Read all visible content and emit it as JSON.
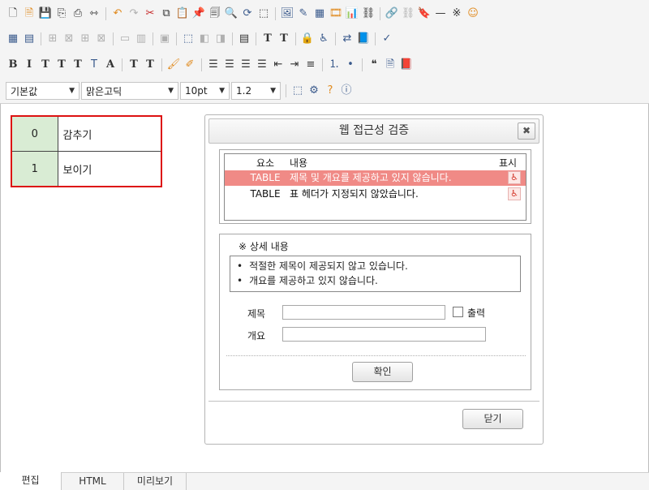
{
  "toolbar": {
    "row1": [
      {
        "name": "new-document-icon",
        "glyph": "🗋",
        "c": "k"
      },
      {
        "name": "template-icon",
        "glyph": "🗎",
        "c": "o"
      },
      {
        "name": "save-icon",
        "glyph": "💾",
        "c": ""
      },
      {
        "name": "copy-doc-icon",
        "glyph": "⎘",
        "c": "k"
      },
      {
        "name": "print-icon",
        "glyph": "⎙",
        "c": "k"
      },
      {
        "name": "page-break-icon",
        "glyph": "⇿",
        "c": "k"
      },
      {
        "sep": true
      },
      {
        "name": "undo-icon",
        "glyph": "↶",
        "c": "o"
      },
      {
        "name": "redo-icon",
        "glyph": "↷",
        "c": "g"
      },
      {
        "name": "cut-icon",
        "glyph": "✂",
        "c": "r"
      },
      {
        "name": "copy-icon",
        "glyph": "⧉",
        "c": "k"
      },
      {
        "name": "paste-icon",
        "glyph": "📋",
        "c": "o"
      },
      {
        "name": "paste-special-icon",
        "glyph": "📌",
        "c": "k"
      },
      {
        "name": "paste-text-icon",
        "glyph": "🗐",
        "c": "k"
      },
      {
        "name": "find-icon",
        "glyph": "🔍",
        "c": "k"
      },
      {
        "name": "replace-icon",
        "glyph": "⟳",
        "c": ""
      },
      {
        "name": "select-all-icon",
        "glyph": "⬚",
        "c": "k"
      },
      {
        "sep": true
      },
      {
        "name": "image-icon",
        "glyph": "🖼",
        "c": ""
      },
      {
        "name": "edit-image-icon",
        "glyph": "✎",
        "c": ""
      },
      {
        "name": "background-icon",
        "glyph": "▦",
        "c": ""
      },
      {
        "name": "media-icon",
        "glyph": "🎞",
        "c": "o"
      },
      {
        "name": "chart-icon",
        "glyph": "📊",
        "c": ""
      },
      {
        "name": "link-icon",
        "glyph": "⛓",
        "c": "k"
      },
      {
        "sep": true
      },
      {
        "name": "hyperlink-icon",
        "glyph": "🔗",
        "c": "k"
      },
      {
        "name": "unlink-icon",
        "glyph": "⛓",
        "c": "g"
      },
      {
        "name": "bookmark-icon",
        "glyph": "🔖",
        "c": ""
      },
      {
        "name": "horizontal-line-icon",
        "glyph": "—",
        "c": "k"
      },
      {
        "name": "special-char-icon",
        "glyph": "※",
        "c": "k"
      },
      {
        "name": "emoticon-icon",
        "glyph": "☺",
        "c": "o"
      }
    ],
    "row2": [
      {
        "name": "table-icon",
        "glyph": "▦",
        "c": ""
      },
      {
        "name": "table-props-icon",
        "glyph": "▤",
        "c": ""
      },
      {
        "sep": true
      },
      {
        "name": "insert-row-icon",
        "glyph": "⊞",
        "c": "g"
      },
      {
        "name": "delete-row-icon",
        "glyph": "⊠",
        "c": "g"
      },
      {
        "name": "insert-col-icon",
        "glyph": "⊞",
        "c": "g"
      },
      {
        "name": "delete-col-icon",
        "glyph": "⊠",
        "c": "g"
      },
      {
        "sep": true
      },
      {
        "name": "merge-cells-icon",
        "glyph": "▭",
        "c": "g"
      },
      {
        "name": "split-cells-icon",
        "glyph": "▥",
        "c": "g"
      },
      {
        "sep": true
      },
      {
        "name": "cell-props-icon",
        "glyph": "▣",
        "c": "g"
      },
      {
        "sep": true
      },
      {
        "name": "layer-icon",
        "glyph": "⬚",
        "c": ""
      },
      {
        "name": "bring-front-icon",
        "glyph": "◧",
        "c": "g"
      },
      {
        "name": "send-back-icon",
        "glyph": "◨",
        "c": "g"
      },
      {
        "sep": true
      },
      {
        "name": "form-icon",
        "glyph": "▤",
        "c": "k"
      },
      {
        "sep": true
      },
      {
        "name": "text-underline-t-icon",
        "glyph": "T",
        "c": "txt"
      },
      {
        "name": "text-style-t-icon",
        "glyph": "T",
        "c": "txt"
      },
      {
        "sep": true
      },
      {
        "name": "lock-icon",
        "glyph": "🔒",
        "c": "o"
      },
      {
        "name": "accessibility-icon",
        "glyph": "♿",
        "c": ""
      },
      {
        "sep": true
      },
      {
        "name": "translate-icon",
        "glyph": "⇄",
        "c": ""
      },
      {
        "name": "dictionary-icon",
        "glyph": "📘",
        "c": ""
      },
      {
        "sep": true
      },
      {
        "name": "spellcheck-icon",
        "glyph": "✓",
        "c": ""
      }
    ],
    "row3": [
      {
        "name": "bold-icon",
        "glyph": "B",
        "c": "txt"
      },
      {
        "name": "italic-icon",
        "glyph": "I",
        "c": "txt"
      },
      {
        "name": "underline-icon",
        "glyph": "T",
        "c": "txt"
      },
      {
        "name": "strikethrough-icon",
        "glyph": "T",
        "c": "txt"
      },
      {
        "name": "font-color-icon",
        "glyph": "T",
        "c": "txt"
      },
      {
        "name": "highlight-icon",
        "glyph": "T",
        "c": ""
      },
      {
        "name": "clear-format-icon",
        "glyph": "A",
        "c": "txt"
      },
      {
        "sep": true
      },
      {
        "name": "subscript-icon",
        "glyph": "T",
        "c": "txt"
      },
      {
        "name": "superscript-icon",
        "glyph": "T",
        "c": "txt"
      },
      {
        "sep": true
      },
      {
        "name": "format-painter-icon",
        "glyph": "🖌",
        "c": "o"
      },
      {
        "name": "clear-painter-icon",
        "glyph": "✐",
        "c": "o"
      },
      {
        "sep": true
      },
      {
        "name": "align-left-icon",
        "glyph": "☰",
        "c": "k"
      },
      {
        "name": "align-center-icon",
        "glyph": "☰",
        "c": "k"
      },
      {
        "name": "align-right-icon",
        "glyph": "☰",
        "c": "k"
      },
      {
        "name": "align-justify-icon",
        "glyph": "☰",
        "c": "k"
      },
      {
        "name": "outdent-icon",
        "glyph": "⇤",
        "c": "k"
      },
      {
        "name": "indent-icon",
        "glyph": "⇥",
        "c": "k"
      },
      {
        "name": "line-icon",
        "glyph": "≡",
        "c": "k"
      },
      {
        "sep": true
      },
      {
        "name": "ordered-list-icon",
        "glyph": "⒈",
        "c": ""
      },
      {
        "name": "unordered-list-icon",
        "glyph": "•",
        "c": ""
      },
      {
        "sep": true
      },
      {
        "name": "quote-icon",
        "glyph": "❝",
        "c": "k"
      },
      {
        "name": "document-icon",
        "glyph": "🗎",
        "c": ""
      },
      {
        "name": "pdf-icon",
        "glyph": "📕",
        "c": "r"
      }
    ]
  },
  "format_bar": {
    "style": "기본값",
    "font": "맑은고딕",
    "size": "10pt",
    "line_height": "1.2"
  },
  "table": {
    "rows": [
      {
        "num": "0",
        "label": "감추기"
      },
      {
        "num": "1",
        "label": "보이기"
      }
    ]
  },
  "dialog": {
    "title": "웹 접근성 검증",
    "close": "✖",
    "results": {
      "headers": {
        "element": "요소",
        "content": "내용",
        "mark": "표시"
      },
      "rows": [
        {
          "element": "TABLE",
          "content": "제목 및 개요를 제공하고 있지 않습니다."
        },
        {
          "element": "TABLE",
          "content": "표 헤더가 지정되지 않았습니다."
        }
      ]
    },
    "detail": {
      "title": "※ 상세 내용",
      "items": [
        "적절한 제목이 제공되지 않고 있습니다.",
        "개요를 제공하고 있지 않습니다."
      ],
      "title_field_label": "제목",
      "title_field_value": "",
      "print_label": "출력",
      "summary_field_label": "개요",
      "summary_field_value": "",
      "confirm_label": "확인"
    },
    "close_label": "닫기"
  },
  "tabs": [
    "편집",
    "HTML",
    "미리보기"
  ]
}
